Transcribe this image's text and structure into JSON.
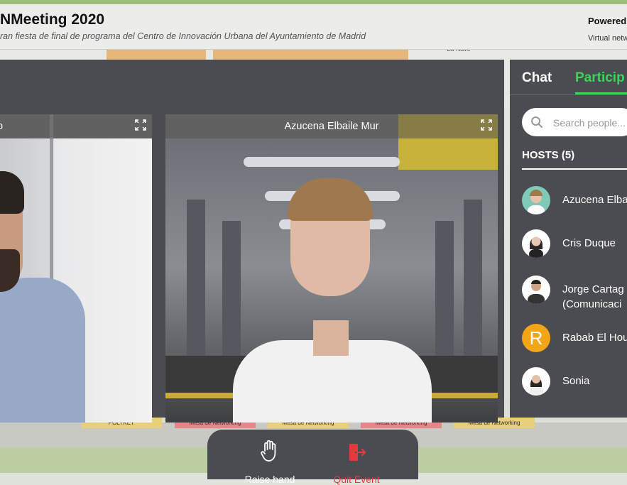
{
  "header": {
    "title": "NMeeting 2020",
    "subtitle": "ran fiesta de final de programa del Centro de Innovación Urbana del Ayuntamiento de Madrid",
    "powered": "Powered",
    "powered_sub": "Virtual netw"
  },
  "map": {
    "top_label": "La Nave",
    "tables": [
      "POLYKEY",
      "Mesa de Networking",
      "Mesa de Networking",
      "Mesa de Networking",
      "Mesa de Networking",
      "Mesa de Networking"
    ]
  },
  "videos": {
    "left_name": "o",
    "right_name": "Azucena Elbaile Mur"
  },
  "sidebar": {
    "tab_chat": "Chat",
    "tab_participants": "Particip",
    "search_placeholder": "Search people...",
    "hosts_header": "HOSTS (5)",
    "hosts": [
      {
        "name": "Azucena Elba",
        "name2": ""
      },
      {
        "name": "Cris Duque",
        "name2": ""
      },
      {
        "name": "Jorge Cartag",
        "name2": "(Comunicaci"
      },
      {
        "name": "Rabab El Hou",
        "name2": "",
        "initial": "R"
      },
      {
        "name": "Sonia",
        "name2": ""
      }
    ]
  },
  "controls": {
    "raise_hand": "Raise hand",
    "quit_event": "Quit Event"
  },
  "colors": {
    "panel": "#4b4c51",
    "accent_green": "#37d65a",
    "quit_red": "#e33b3b",
    "avatar_orange": "#f2a516"
  }
}
